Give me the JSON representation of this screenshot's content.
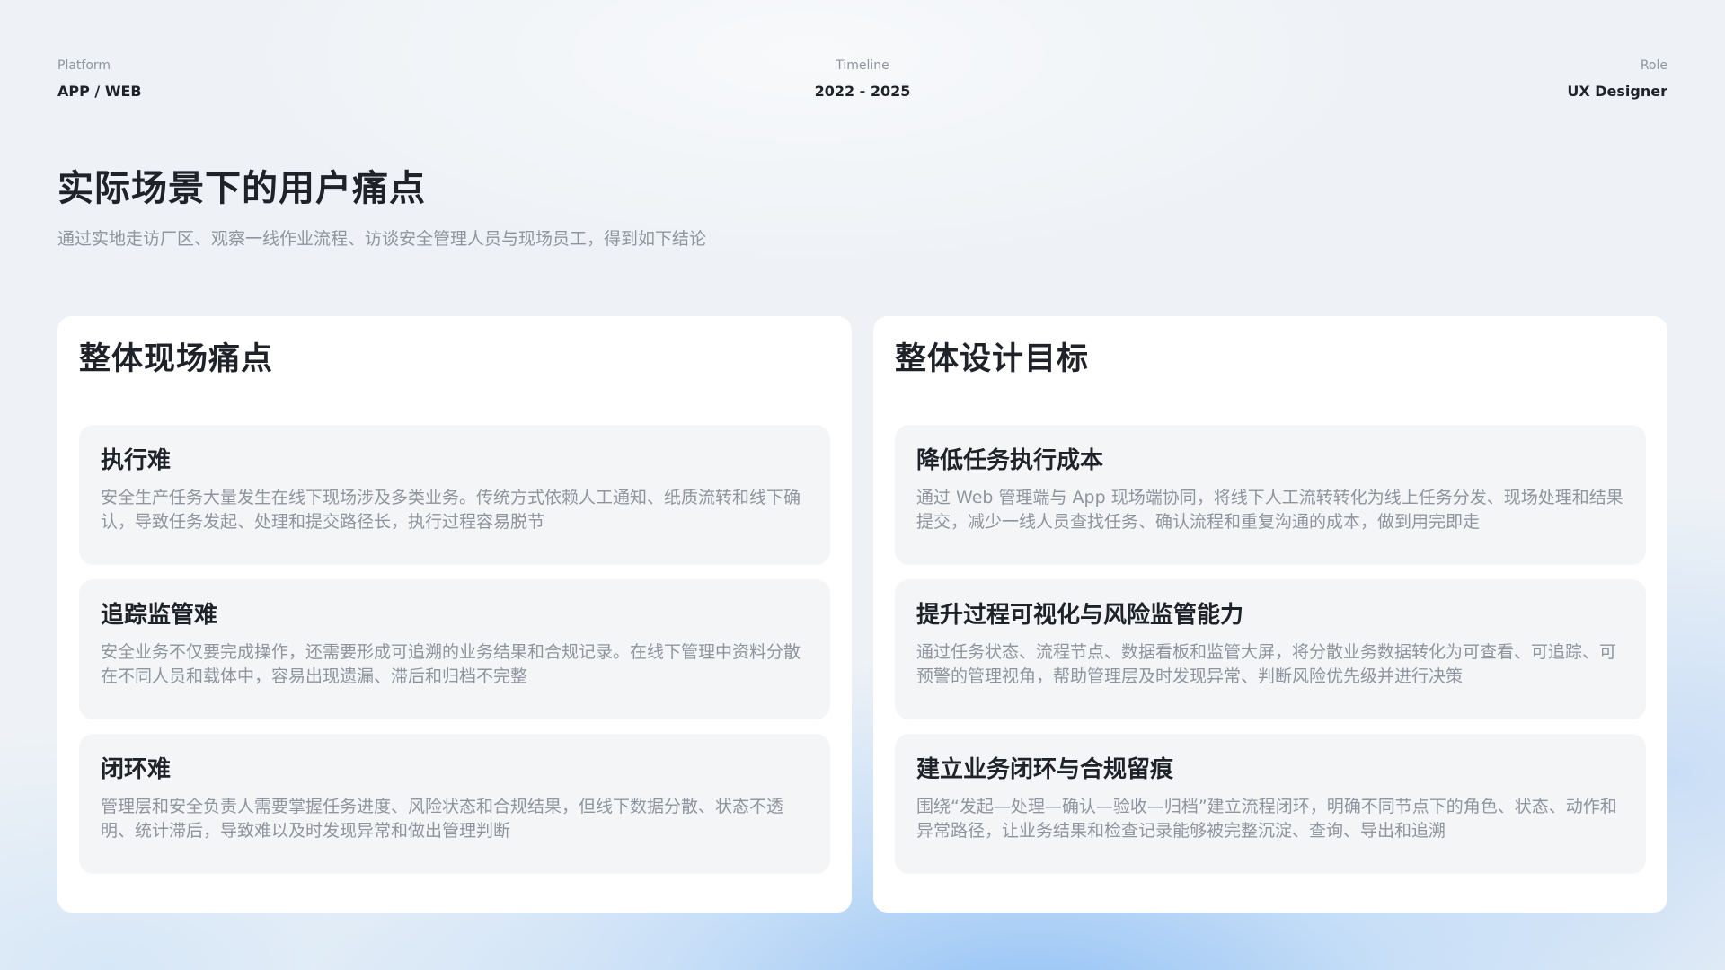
{
  "meta": {
    "platform_label": "Platform",
    "platform_value": "APP / WEB",
    "timeline_label": "Timeline",
    "timeline_value": "2022 - 2025",
    "role_label": "Role",
    "role_value": "UX Designer"
  },
  "page": {
    "title": "实际场景下的用户痛点",
    "subtitle": "通过实地走访厂区、观察一线作业流程、访谈安全管理人员与现场员工，得到如下结论"
  },
  "pain_points": {
    "title": "整体现场痛点",
    "cards": [
      {
        "title": "执行难",
        "desc": "安全生产任务大量发生在线下现场涉及多类业务。传统方式依赖人工通知、纸质流转和线下确认，导致任务发起、处理和提交路径长，执行过程容易脱节"
      },
      {
        "title": "追踪监管难",
        "desc": "安全业务不仅要完成操作，还需要形成可追溯的业务结果和合规记录。在线下管理中资料分散在不同人员和载体中，容易出现遗漏、滞后和归档不完整"
      },
      {
        "title": "闭环难",
        "desc": "管理层和安全负责人需要掌握任务进度、风险状态和合规结果，但线下数据分散、状态不透明、统计滞后，导致难以及时发现异常和做出管理判断"
      }
    ]
  },
  "design_goals": {
    "title": "整体设计目标",
    "cards": [
      {
        "title": "降低任务执行成本",
        "desc": "通过 Web 管理端与 App 现场端协同，将线下人工流转转化为线上任务分发、现场处理和结果提交，减少一线人员查找任务、确认流程和重复沟通的成本，做到用完即走"
      },
      {
        "title": "提升过程可视化与风险监管能力",
        "desc": "通过任务状态、流程节点、数据看板和监管大屏，将分散业务数据转化为可查看、可追踪、可预警的管理视角，帮助管理层及时发现异常、判断风险优先级并进行决策"
      },
      {
        "title": "建立业务闭环与合规留痕",
        "desc": "围绕“发起—处理—确认—验收—归档”建立流程闭环，明确不同节点下的角色、状态、动作和异常路径，让业务结果和检查记录能够被完整沉淀、查询、导出和追溯"
      }
    ]
  }
}
